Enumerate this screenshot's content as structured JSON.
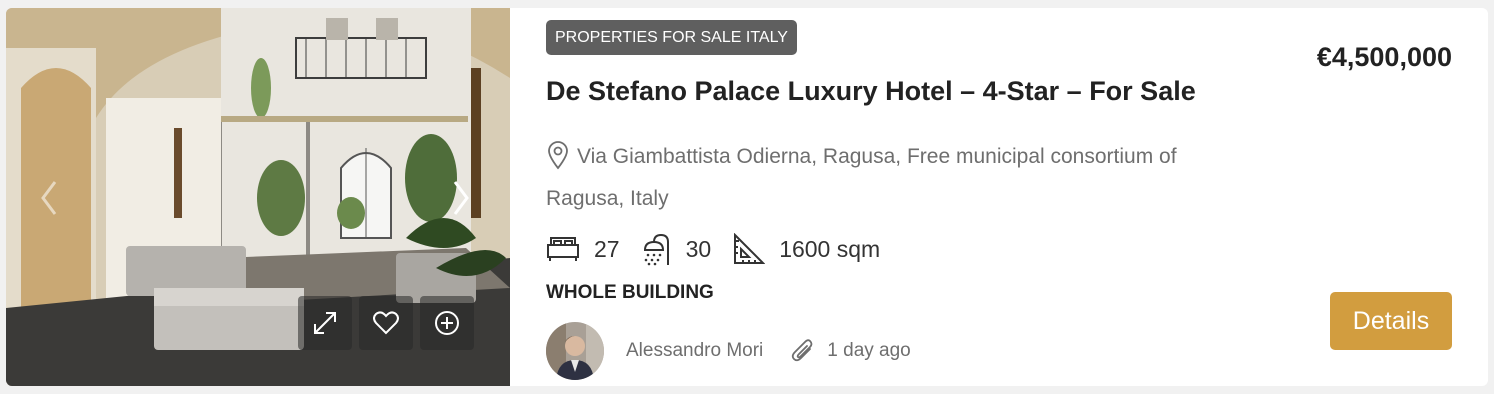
{
  "listing": {
    "category_tag": "PROPERTIES FOR SALE ITALY",
    "price": "€4,500,000",
    "title": "De Stefano Palace Luxury Hotel – 4-Star – For Sale",
    "address_line1": "Via Giambattista Odierna, Ragusa, Free municipal consortium of",
    "address_line2": "Ragusa, Italy",
    "bedrooms": "27",
    "bathrooms": "30",
    "area": "1600 sqm",
    "property_type": "WHOLE BUILDING",
    "agent_name": "Alessandro Mori",
    "posted": "1 day ago",
    "details_label": "Details"
  },
  "colors": {
    "accent": "#d29d3f",
    "tag_bg": "#5f5f5f",
    "text_dark": "#222222",
    "text_muted": "#6e6e6e"
  },
  "icons": {
    "photo_prev": "chevron-left-icon",
    "photo_next": "chevron-right-icon",
    "expand": "expand-icon",
    "favorite": "heart-icon",
    "compare": "plus-circle-icon",
    "location": "map-pin-icon",
    "bed": "bed-icon",
    "bath": "shower-icon",
    "area": "ruler-triangle-icon",
    "attachment": "paperclip-icon"
  }
}
